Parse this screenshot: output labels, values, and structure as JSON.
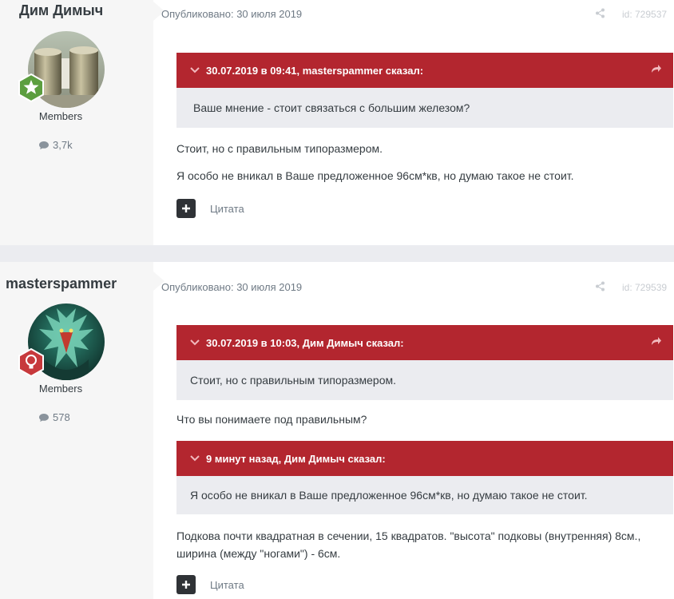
{
  "posts": [
    {
      "author": "Дим Димыч",
      "group": "Members",
      "post_count": "3,7k",
      "published": "Опубликовано: 30 июля 2019",
      "post_id": "id: 729537",
      "avatar_icon": "cans-photo",
      "badge_icon": "star-badge-icon",
      "badge_color": "#5c9e3f",
      "quotes": [
        {
          "header": "30.07.2019 в 09:41, masterspammer сказал:",
          "text": "Ваше мнение - стоит связаться с большим железом?"
        }
      ],
      "paragraphs": [
        "Стоит, но с правильным типоразмером.",
        "Я особо не вникал в Ваше предложенное 96см*кв, но думаю такое не стоит."
      ],
      "cite_label": "Цитата"
    },
    {
      "author": "masterspammer",
      "group": "Members",
      "post_count": "578",
      "published": "Опубликовано: 30 июля 2019",
      "post_id": "id: 729539",
      "avatar_icon": "dragon-art",
      "badge_icon": "lightbulb-badge-icon",
      "badge_color": "#c7393c",
      "quotes": [
        {
          "header": "30.07.2019 в 10:03, Дим Димыч сказал:",
          "text": "Стоит, но с правильным типоразмером."
        },
        {
          "header": "9 минут назад, Дим Димыч сказал:",
          "text": "Я особо не вникал в Ваше предложенное 96см*кв, но думаю такое не стоит."
        }
      ],
      "paragraphs": [
        "Что вы понимаете под правильным?",
        "Подкова почти квадратная в сечении, 15 квадратов. \"высота\" подковы (внутренняя) 8см.,",
        "ширина (между \"ногами\") - 6см."
      ],
      "cite_label": "Цитата"
    }
  ],
  "colors": {
    "quote_header": "#b3262f",
    "quote_body": "#ebecf0",
    "sidebar": "#f6f6f6"
  }
}
